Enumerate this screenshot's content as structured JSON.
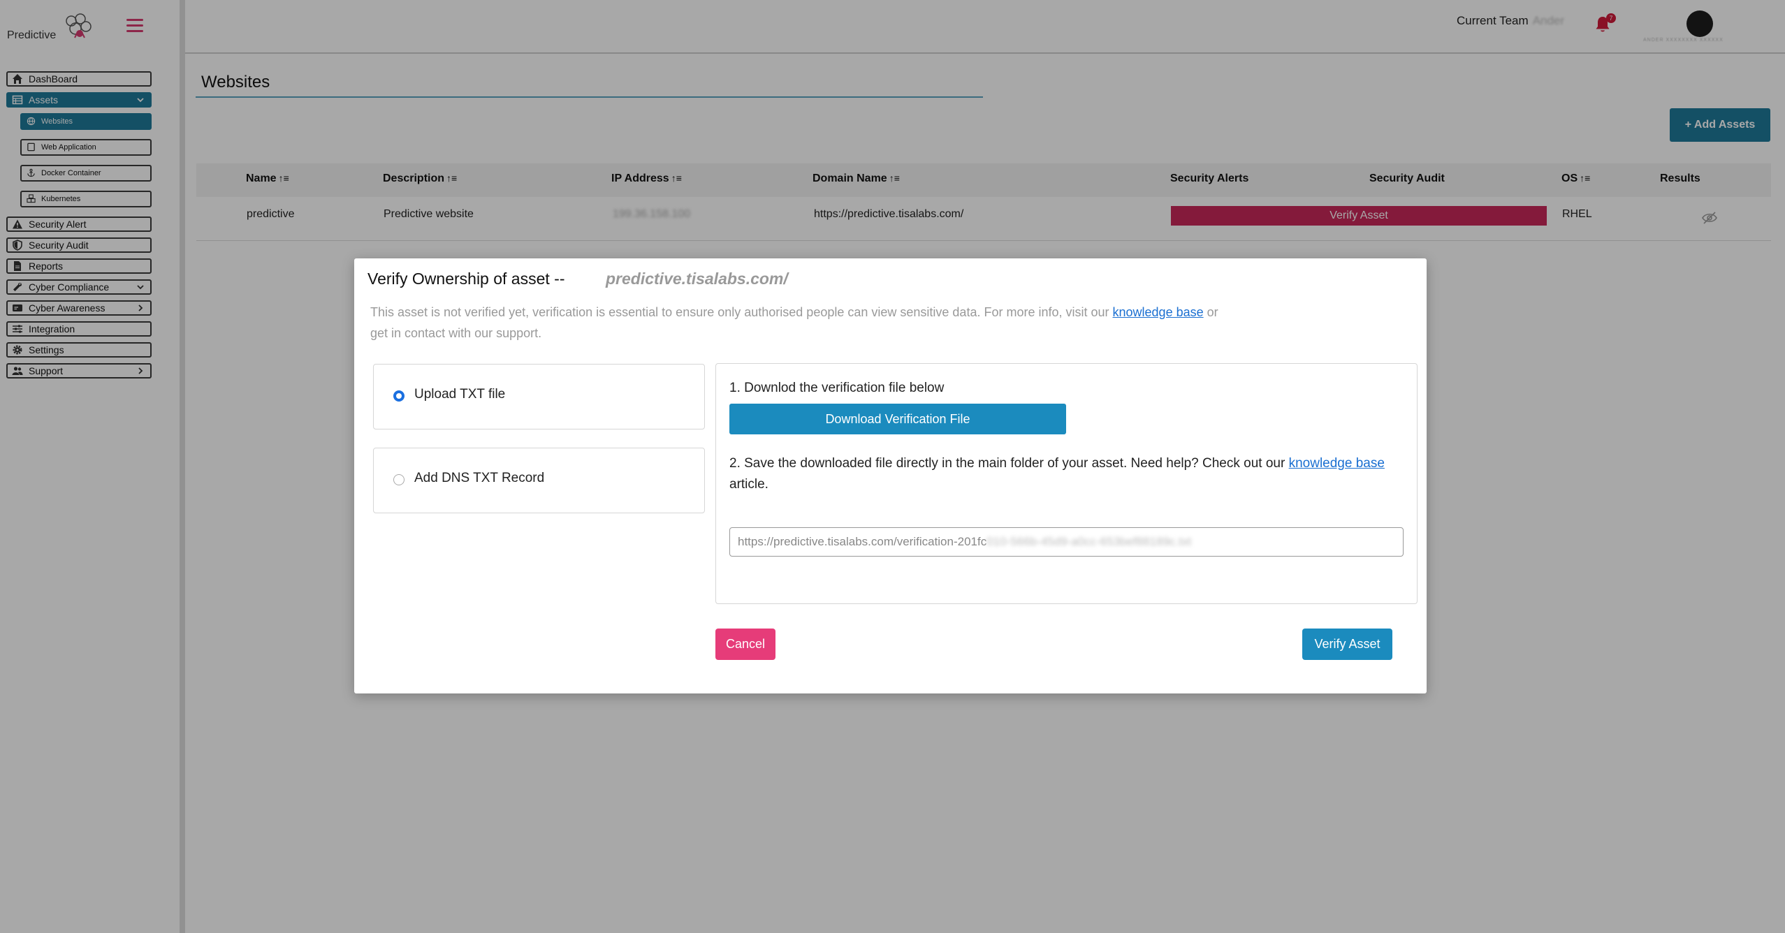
{
  "brand": {
    "name": "Predictive"
  },
  "header": {
    "team_label": "Current Team",
    "team_name": "Ander",
    "notification_count": "7",
    "user_caption": "ANDER XXXXXXXX XXXXXX"
  },
  "sidebar": {
    "items": [
      {
        "label": "DashBoard",
        "icon": "home-icon"
      },
      {
        "label": "Assets",
        "icon": "table-icon",
        "expanded": true
      },
      {
        "label": "Security Alert",
        "icon": "warning-icon"
      },
      {
        "label": "Security Audit",
        "icon": "shield-icon"
      },
      {
        "label": "Reports",
        "icon": "document-icon"
      },
      {
        "label": "Cyber Compliance",
        "icon": "wrench-icon",
        "chevron": "down"
      },
      {
        "label": "Cyber Awareness",
        "icon": "card-icon",
        "chevron": "right"
      },
      {
        "label": "Integration",
        "icon": "sliders-icon"
      },
      {
        "label": "Settings",
        "icon": "gear-icon"
      },
      {
        "label": "Support",
        "icon": "users-icon",
        "chevron": "right"
      }
    ],
    "assets_sub": [
      {
        "label": "Websites",
        "icon": "globe-icon",
        "active": true
      },
      {
        "label": "Web Application",
        "icon": "window-icon"
      },
      {
        "label": "Docker Container",
        "icon": "anchor-icon"
      },
      {
        "label": "Kubernetes",
        "icon": "cubes-icon"
      }
    ]
  },
  "main": {
    "title": "Websites",
    "add_button": "+ Add Assets",
    "table": {
      "columns": [
        "Name",
        "Description",
        "IP Address",
        "Domain Name",
        "Security Alerts",
        "Security Audit",
        "OS",
        "Results"
      ],
      "sortable": [
        true,
        true,
        true,
        true,
        false,
        false,
        true,
        false
      ],
      "sort_glyph": "↑≡",
      "rows": [
        {
          "name": "predictive",
          "description": "Predictive website",
          "ip": "199.36.158.100",
          "domain": "https://predictive.tisalabs.com/",
          "action": "Verify Asset",
          "os": "RHEL"
        }
      ]
    }
  },
  "modal": {
    "title": "Verify Ownership of asset --",
    "asset": "predictive.tisalabs.com/",
    "desc_before": "This asset is not verified yet, verification is essential to ensure only authorised people can view sensitive data. For more info, visit our ",
    "desc_link": "knowledge base",
    "desc_after": " or get in contact with our support.",
    "options": [
      {
        "label": "Upload TXT file",
        "selected": true
      },
      {
        "label": "Add DNS TXT Record",
        "selected": false
      }
    ],
    "step1": "1. Downlod the verification file below",
    "download_button": "Download Verification File",
    "step2_before": "2. Save the downloaded file directly in the main folder of your asset. Need help? Check out our ",
    "step2_link": "knowledge base",
    "step2_after": " article.",
    "url_visible": "https://predictive.tisalabs.com/verification-201fc",
    "url_hidden": "010-566b-45d9-a0cc-653bef88189c.txt",
    "cancel": "Cancel",
    "verify": "Verify Asset"
  },
  "colors": {
    "primary": "#1f7a9a",
    "accent_pink": "#e63c79",
    "alert_red": "#c8285a",
    "link": "#1a6fd1"
  }
}
